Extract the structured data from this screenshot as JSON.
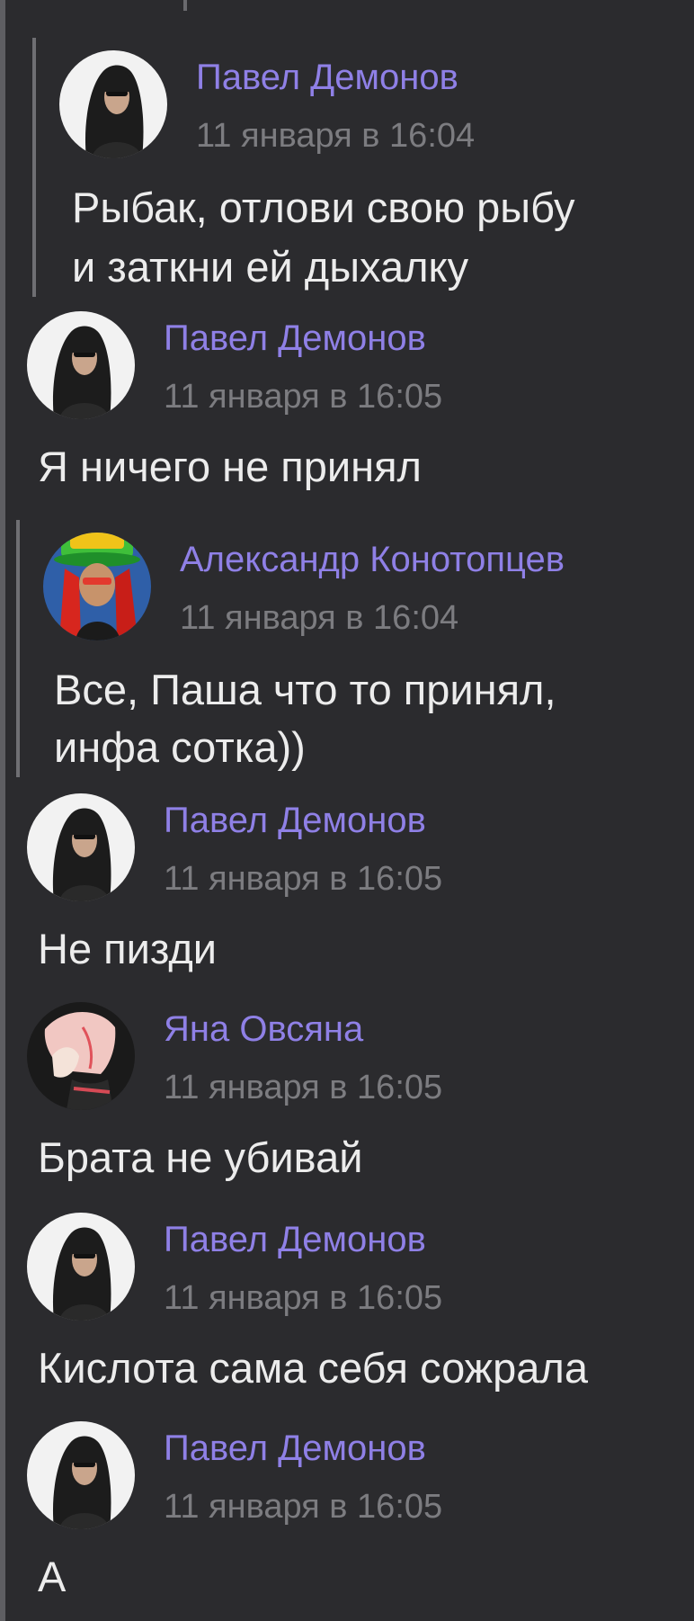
{
  "messages": [
    {
      "author": "Павел Демонов",
      "time": "11 января в 16:04",
      "lines": [
        "Рыбак, отлови свою рыбу",
        "и заткни ей дыхалку"
      ],
      "avatar": "long-hair-man-avatar"
    },
    {
      "author": "Павел Демонов",
      "time": "11 января в 16:05",
      "lines": [
        "Я ничего не принял"
      ],
      "avatar": "long-hair-man-avatar"
    },
    {
      "author": "Александр Конотопцев",
      "time": "11 января в 16:04",
      "lines": [
        "Все, Паша что то принял,",
        "инфа сотка))"
      ],
      "avatar": "green-hat-avatar"
    },
    {
      "author": "Павел Демонов",
      "time": "11 января в 16:05",
      "lines": [
        "Не пизди"
      ],
      "avatar": "long-hair-man-avatar"
    },
    {
      "author": "Яна Овсяна",
      "time": "11 января в 16:05",
      "lines": [
        "Брата не убивай"
      ],
      "avatar": "anime-girl-avatar"
    },
    {
      "author": "Павел Демонов",
      "time": "11 января в 16:05",
      "lines": [
        "Кислота сама себя сожрала"
      ],
      "avatar": "long-hair-man-avatar"
    },
    {
      "author": "Павел Демонов",
      "time": "11 января в 16:05",
      "lines": [
        "А"
      ],
      "avatar": "long-hair-man-avatar"
    }
  ],
  "colors": {
    "background": "#2b2b2e",
    "author": "#8f80e6",
    "time": "#7c7c80",
    "text": "#ececec",
    "thread_line": "#5e5e62"
  }
}
